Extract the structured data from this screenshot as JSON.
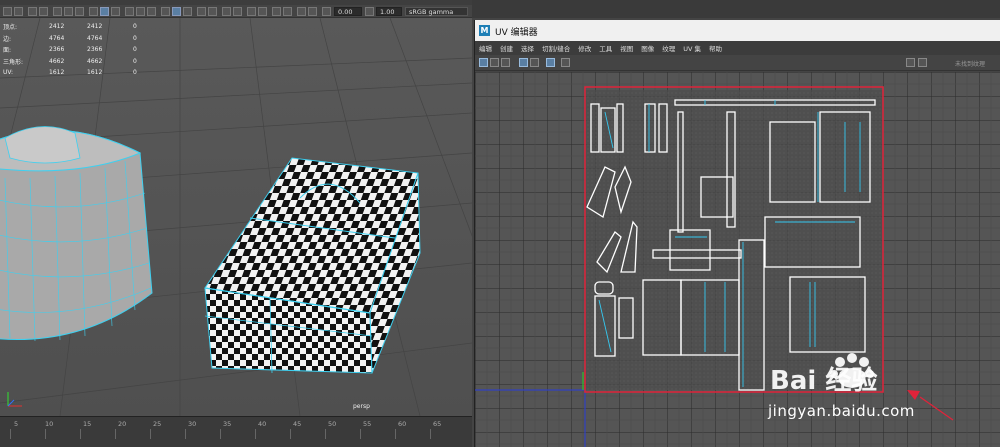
{
  "top_menu": [
    "模型"
  ],
  "toolbar": {
    "exposure": "0.00",
    "gamma": "1.00",
    "colorspace": "sRGB gamma"
  },
  "hud": {
    "rows": [
      {
        "label": "顶点:",
        "v1": "2412",
        "v2": "2412",
        "v3": "0"
      },
      {
        "label": "边:",
        "v1": "4764",
        "v2": "4764",
        "v3": "0"
      },
      {
        "label": "面:",
        "v1": "2366",
        "v2": "2366",
        "v3": "0"
      },
      {
        "label": "三角形:",
        "v1": "4662",
        "v2": "4662",
        "v3": "0"
      },
      {
        "label": "UV:",
        "v1": "1612",
        "v2": "1612",
        "v3": "0"
      }
    ]
  },
  "viewport_label": "persp",
  "timeline": {
    "ticks": [
      "5",
      "10",
      "15",
      "20",
      "25",
      "30",
      "35",
      "40",
      "45",
      "50",
      "55",
      "60",
      "65"
    ]
  },
  "uv_editor": {
    "title": "UV 编辑器",
    "menu": [
      "编辑",
      "创建",
      "选择",
      "切割/缝合",
      "修改",
      "工具",
      "视图",
      "图像",
      "纹理",
      "UV 集",
      "帮助"
    ],
    "texture_dropdown": "未找到纹理"
  },
  "watermark": {
    "text": "jingyan.baidu.com",
    "logo": "Bai 经验"
  },
  "colors": {
    "uv_shell": "#ffffff",
    "uv_edge_highlight": "#35c8f0",
    "selection_frame": "#e0233a",
    "wireframe": "#3ed0f0"
  }
}
